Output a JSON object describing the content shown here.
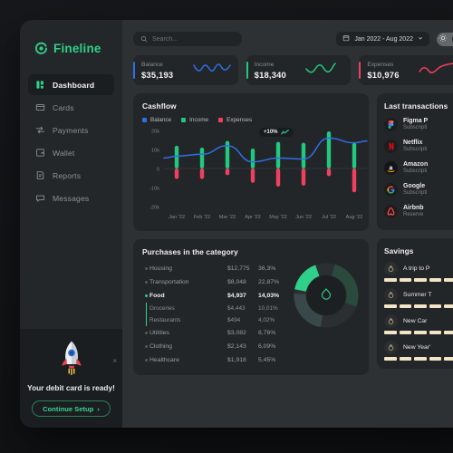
{
  "brand": {
    "name": "Fineline",
    "logo_icon": "fineline-swirl-icon"
  },
  "sidebar": {
    "items": [
      {
        "label": "Dashboard",
        "icon": "dashboard-icon",
        "active": true
      },
      {
        "label": "Cards",
        "icon": "card-icon",
        "active": false
      },
      {
        "label": "Payments",
        "icon": "payments-icon",
        "active": false
      },
      {
        "label": "Wallet",
        "icon": "wallet-icon",
        "active": false
      },
      {
        "label": "Reports",
        "icon": "reports-icon",
        "active": false
      },
      {
        "label": "Messages",
        "icon": "messages-icon",
        "active": false
      }
    ],
    "promo": {
      "illustration": "rocket-icon",
      "text": "Your debit card is ready!",
      "button": "Continue Setup",
      "button_chevron": "›",
      "close_icon": "close-icon"
    }
  },
  "topbar": {
    "search_placeholder": "Search...",
    "search_value": "",
    "search_icon": "search-icon",
    "date_range": "Jan 2022 - Aug 2022",
    "calendar_icon": "calendar-icon",
    "caret_icon": "chevron-down-icon",
    "theme_icon": "sun-icon"
  },
  "stats": [
    {
      "label": "Balance",
      "value": "$35,193",
      "color": "#2f6fe4"
    },
    {
      "label": "Income",
      "value": "$18,340",
      "color": "#22c87f"
    },
    {
      "label": "Expenses",
      "value": "$10,976",
      "color": "#f04060"
    }
  ],
  "cashflow": {
    "title": "Cashflow",
    "legend": [
      {
        "label": "Balance",
        "color": "#2f6fe4"
      },
      {
        "label": "Income",
        "color": "#22c87f"
      },
      {
        "label": "Expenses",
        "color": "#f04060"
      }
    ],
    "tooltip": {
      "text": "+10%",
      "icon": "trend-up-icon"
    }
  },
  "chart_data": [
    {
      "type": "bar",
      "title": "Cashflow",
      "categories": [
        "Jan '22",
        "Feb '22",
        "Mar '22",
        "Apr '22",
        "May '22",
        "Jun '22",
        "Jul '22",
        "Aug '22"
      ],
      "ytick_labels": [
        "20k",
        "10k",
        "0",
        "-10k",
        "-20k"
      ],
      "ylim": [
        -20000,
        20000
      ],
      "xlabel": "",
      "ylabel": "",
      "grid": false,
      "legend_position": "top-left",
      "series": [
        {
          "name": "Income",
          "color": "#22c87f",
          "values": [
            12000,
            11000,
            14500,
            10500,
            14000,
            13500,
            19500,
            13500
          ]
        },
        {
          "name": "Expenses",
          "color": "#f04060",
          "values": [
            -5500,
            -5500,
            -3500,
            -7500,
            -9500,
            -9000,
            -4000,
            -12500
          ]
        },
        {
          "name": "Balance",
          "color": "#2f6fe4",
          "type": "line",
          "values": [
            6500,
            7500,
            12000,
            3500,
            5500,
            5000,
            16000,
            13500
          ]
        }
      ]
    },
    {
      "type": "pie",
      "title": "Purchases in the category",
      "categories": [
        "Housing",
        "Transportation",
        "Food",
        "Utilities",
        "Clothing",
        "Healthcare"
      ],
      "values": [
        36.3,
        22.87,
        14.03,
        8.76,
        6.09,
        5.45
      ],
      "amounts": [
        "$12,775",
        "$8,048",
        "$4,937",
        "$3,082",
        "$2,143",
        "$1,918"
      ],
      "highlight": "Food"
    }
  ],
  "purchases": {
    "title": "Purchases in the category",
    "center_icon": "pear-icon",
    "rows": [
      {
        "name": "Housing",
        "amount": "$12,775",
        "percent": "36,3%",
        "active": false,
        "sub": false
      },
      {
        "name": "Transportation",
        "amount": "$8,048",
        "percent": "22,87%",
        "active": false,
        "sub": false
      },
      {
        "name": "Food",
        "amount": "$4,937",
        "percent": "14,03%",
        "active": true,
        "sub": false
      },
      {
        "name": "Groceries",
        "amount": "$4,443",
        "percent": "10,01%",
        "active": false,
        "sub": true
      },
      {
        "name": "Restaurants",
        "amount": "$494",
        "percent": "4,02%",
        "active": false,
        "sub": true
      },
      {
        "name": "Utilities",
        "amount": "$3,082",
        "percent": "8,76%",
        "active": false,
        "sub": false
      },
      {
        "name": "Clothing",
        "amount": "$2,143",
        "percent": "6,09%",
        "active": false,
        "sub": false
      },
      {
        "name": "Healthcare",
        "amount": "$1,918",
        "percent": "5,45%",
        "active": false,
        "sub": false
      }
    ]
  },
  "transactions": {
    "title": "Last transactions",
    "rows": [
      {
        "name": "Figma P",
        "sub": "Subscripti",
        "logo": "figma-logo-icon"
      },
      {
        "name": "Netflix",
        "sub": "Subscripti",
        "logo": "netflix-logo-icon"
      },
      {
        "name": "Amazon",
        "sub": "Subscripti",
        "logo": "amazon-logo-icon"
      },
      {
        "name": "Google",
        "sub": "Subscripti",
        "logo": "google-logo-icon"
      },
      {
        "name": "Airbnb",
        "sub": "Reserve",
        "logo": "airbnb-logo-icon"
      }
    ]
  },
  "savings": {
    "title": "Savings",
    "goal_icon": "money-bag-icon",
    "rows": [
      {
        "name": "A trip to P",
        "segments": 5,
        "filled": 5
      },
      {
        "name": "Summer T",
        "segments": 5,
        "filled": 5
      },
      {
        "name": "New Car",
        "segments": 5,
        "filled": 5
      },
      {
        "name": "New Year'",
        "segments": 5,
        "filled": 5
      }
    ]
  }
}
